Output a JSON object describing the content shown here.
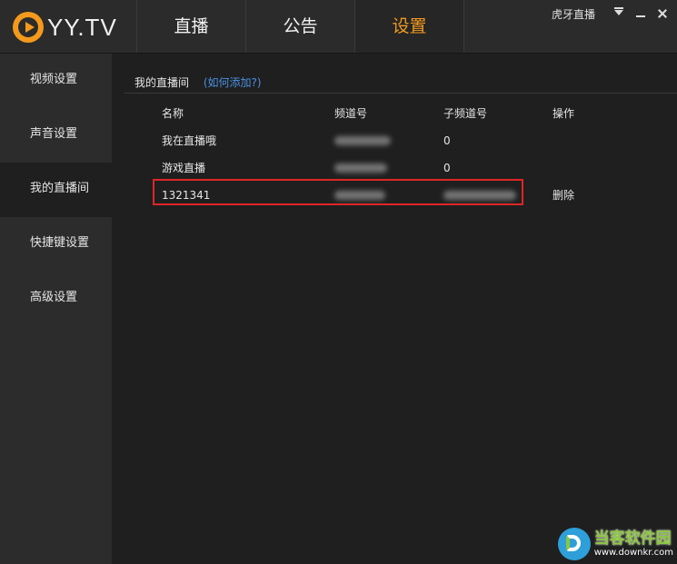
{
  "app": {
    "logo_text": "YY.TV",
    "brand": "虎牙直播"
  },
  "tabs": [
    {
      "label": "直播"
    },
    {
      "label": "公告"
    },
    {
      "label": "设置"
    }
  ],
  "sidebar": {
    "items": [
      {
        "label": "视频设置"
      },
      {
        "label": "声音设置"
      },
      {
        "label": "我的直播间"
      },
      {
        "label": "快捷键设置"
      },
      {
        "label": "高级设置"
      }
    ]
  },
  "main": {
    "section_title": "我的直播间",
    "help_link": "(如何添加?)",
    "columns": [
      "名称",
      "频道号",
      "子频道号",
      "操作"
    ],
    "rows": [
      {
        "name": "我在直播哦",
        "channel": "",
        "sub_channel": "0",
        "action": ""
      },
      {
        "name": "游戏直播",
        "channel": "",
        "sub_channel": "0",
        "action": ""
      },
      {
        "name": "1321341",
        "channel": "",
        "sub_channel": "",
        "action": "删除"
      }
    ]
  },
  "watermark": {
    "title": "当客软件园",
    "url": "www.downkr.com"
  },
  "colors": {
    "accent": "#f39a1d",
    "link": "#4a90e2",
    "highlight_border": "#e02525"
  }
}
